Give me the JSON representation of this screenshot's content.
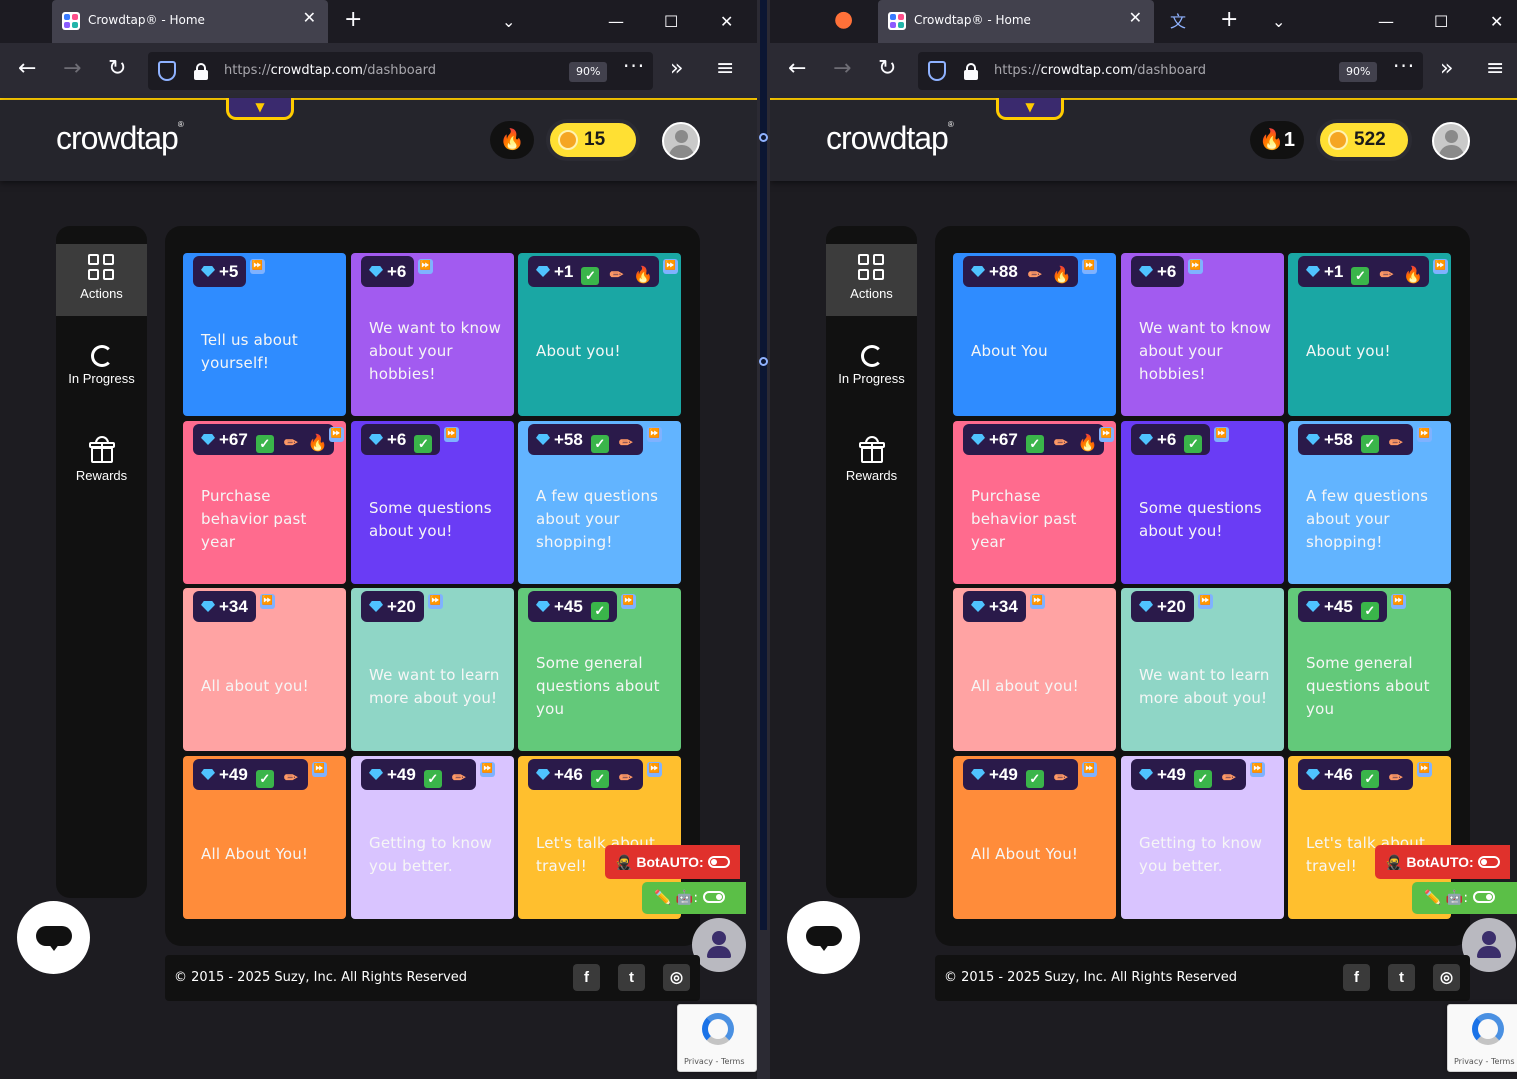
{
  "browser": {
    "tab_title": "Crowdtap® - Home",
    "url_prefix": "https://",
    "url_host": "crowdtap.com",
    "url_path": "/dashboard",
    "zoom": "90%"
  },
  "site": {
    "logo": "crowdtap",
    "nav": [
      {
        "label": "Actions"
      },
      {
        "label": "In Progress"
      },
      {
        "label": "Rewards"
      }
    ],
    "footer": {
      "copyright": "© 2015 - 2025 Suzy, Inc. All Rights Reserved",
      "social": [
        "facebook-icon",
        "twitter-icon",
        "instagram-icon"
      ]
    },
    "recaptcha_terms": "Privacy - Terms",
    "botauto_label": "BotAUTO:",
    "toggle_label": ":"
  },
  "left": {
    "streak": "",
    "coins": "15",
    "cards": [
      {
        "points": "+5",
        "icons": [],
        "text": "Tell us about yourself!",
        "color": "#2f8cff"
      },
      {
        "points": "+6",
        "icons": [],
        "text": "We want to know about your hobbies!",
        "color": "#a25bf0"
      },
      {
        "points": "+1",
        "icons": [
          "check",
          "pencil",
          "flame"
        ],
        "text": "About you!",
        "color": "#1aa7a4"
      },
      {
        "points": "+67",
        "icons": [
          "check",
          "pencil",
          "flame"
        ],
        "text": "Purchase behavior past year",
        "color": "#ff6b8e"
      },
      {
        "points": "+6",
        "icons": [
          "check"
        ],
        "text": "Some questions about you!",
        "color": "#6a3cf5"
      },
      {
        "points": "+58",
        "icons": [
          "check",
          "pencil"
        ],
        "text": "A few questions about your shopping!",
        "color": "#62b4ff"
      },
      {
        "points": "+34",
        "icons": [],
        "text": "All about you!",
        "color": "#ffa3a3"
      },
      {
        "points": "+20",
        "icons": [],
        "text": "We want to learn more about you!",
        "color": "#8fd6c6"
      },
      {
        "points": "+45",
        "icons": [
          "check"
        ],
        "text": "Some general questions about you",
        "color": "#63c97a"
      },
      {
        "points": "+49",
        "icons": [
          "check",
          "pencil"
        ],
        "text": "All About You!",
        "color": "#ff8c3a"
      },
      {
        "points": "+49",
        "icons": [
          "check",
          "pencil"
        ],
        "text": "Getting to know you better.",
        "color": "#d9c4ff"
      },
      {
        "points": "+46",
        "icons": [
          "check",
          "pencil"
        ],
        "text": "Let's talk about travel!",
        "color": "#ffbf2e"
      }
    ]
  },
  "right": {
    "streak": "1",
    "coins": "522",
    "cards": [
      {
        "points": "+88",
        "icons": [
          "pencil",
          "flame"
        ],
        "text": "About You",
        "color": "#2f8cff"
      },
      {
        "points": "+6",
        "icons": [],
        "text": "We want to know about your hobbies!",
        "color": "#a25bf0"
      },
      {
        "points": "+1",
        "icons": [
          "check",
          "pencil",
          "flame"
        ],
        "text": "About you!",
        "color": "#1aa7a4"
      },
      {
        "points": "+67",
        "icons": [
          "check",
          "pencil",
          "flame"
        ],
        "text": "Purchase behavior past year",
        "color": "#ff6b8e"
      },
      {
        "points": "+6",
        "icons": [
          "check"
        ],
        "text": "Some questions about you!",
        "color": "#6a3cf5"
      },
      {
        "points": "+58",
        "icons": [
          "check",
          "pencil"
        ],
        "text": "A few questions about your shopping!",
        "color": "#62b4ff"
      },
      {
        "points": "+34",
        "icons": [],
        "text": "All about you!",
        "color": "#ffa3a3"
      },
      {
        "points": "+20",
        "icons": [],
        "text": "We want to learn more about you!",
        "color": "#8fd6c6"
      },
      {
        "points": "+45",
        "icons": [
          "check"
        ],
        "text": "Some general questions about you",
        "color": "#63c97a"
      },
      {
        "points": "+49",
        "icons": [
          "check",
          "pencil"
        ],
        "text": "All About You!",
        "color": "#ff8c3a"
      },
      {
        "points": "+49",
        "icons": [
          "check",
          "pencil"
        ],
        "text": "Getting to know you better.",
        "color": "#d9c4ff"
      },
      {
        "points": "+46",
        "icons": [
          "check",
          "pencil"
        ],
        "text": "Let's talk about travel!",
        "color": "#ffbf2e"
      }
    ]
  }
}
